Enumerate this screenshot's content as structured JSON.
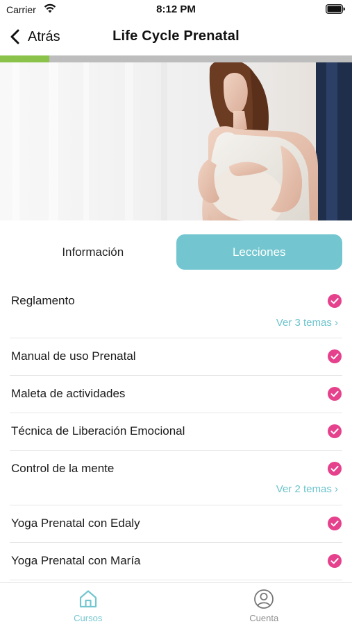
{
  "status_bar": {
    "carrier": "Carrier",
    "time": "8:12 PM"
  },
  "nav": {
    "back_label": "Atrás",
    "title": "Life Cycle Prenatal"
  },
  "progress": {
    "fraction": 0.14
  },
  "hero": {
    "image": "pregnant-woman-photo"
  },
  "tabs": [
    {
      "label": "Información",
      "active": false
    },
    {
      "label": "Lecciones",
      "active": true
    }
  ],
  "lessons": [
    {
      "title": "Reglamento",
      "completed": true,
      "subtopics_label": "Ver 3 temas"
    },
    {
      "title": "Manual de uso Prenatal",
      "completed": true
    },
    {
      "title": "Maleta de actividades",
      "completed": true
    },
    {
      "title": "Técnica de Liberación Emocional",
      "completed": true
    },
    {
      "title": "Control de la mente",
      "completed": true,
      "subtopics_label": "Ver 2 temas"
    },
    {
      "title": "Yoga Prenatal con Edaly",
      "completed": true
    },
    {
      "title": "Yoga Prenatal con María",
      "completed": true
    }
  ],
  "tab_bar": [
    {
      "label": "Cursos",
      "icon": "home-icon",
      "active": true
    },
    {
      "label": "Cuenta",
      "icon": "user-circle-icon",
      "active": false
    }
  ],
  "colors": {
    "accent": "#73c6cf",
    "check": "#e6418c",
    "progress": "#8bc34a",
    "inactive": "#8e8e8e"
  }
}
